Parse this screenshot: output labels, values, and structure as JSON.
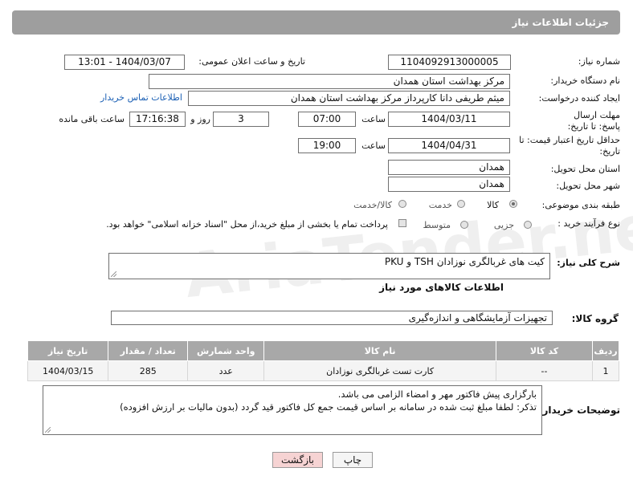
{
  "header": {
    "title": "جزئیات اطلاعات نیاز"
  },
  "fields": {
    "need_number_label": "شماره نیاز:",
    "need_number": "1104092913000005",
    "announce_label": "تاریخ و ساعت اعلان عمومی:",
    "announce_value": "1404/03/07 - 13:01",
    "buyer_label": "نام دستگاه خریدار:",
    "buyer_value": "مرکز بهداشت استان همدان",
    "creator_label": "ایجاد کننده درخواست:",
    "creator_value": "میثم طریفی دانا کارپرداز مرکز بهداشت استان همدان",
    "contact_link": "اطلاعات تماس خریدار",
    "deadline_label": "مهلت ارسال پاسخ: تا تاریخ:",
    "deadline_date": "1404/03/11",
    "time_label": "ساعت",
    "deadline_time": "07:00",
    "days_value": "3",
    "days_label": "روز و",
    "remaining_time": "17:16:38",
    "remaining_label": "ساعت باقی مانده",
    "price_validity_label": "حداقل تاریخ اعتبار قیمت: تا تاریخ:",
    "price_date": "1404/04/31",
    "price_time": "19:00",
    "province_label": "استان محل تحویل:",
    "province_value": "همدان",
    "city_label": "شهر محل تحویل:",
    "city_value": "همدان",
    "category_label": "طبقه بندی موضوعی:",
    "category_options": [
      "کالا",
      "خدمت",
      "کالا/خدمت"
    ],
    "category_selected": "کالا",
    "process_label": "نوع فرآیند خرید :",
    "process_options": [
      "جزیی",
      "متوسط"
    ],
    "payment_note": "پرداخت تمام یا بخشی از مبلغ خرید،از محل \"اسناد خزانه اسلامی\" خواهد بود.",
    "description_label": "شرح کلی نیاز:",
    "description_value": "کیت های غربالگری نوزادان TSH و PKU",
    "goods_info_title": "اطلاعات کالاهای مورد نیاز",
    "goods_group_label": "گروه کالا:",
    "goods_group_value": "تجهیزات آزمایشگاهی و اندازه‌گیری",
    "buyer_notes_label": "توضیحات خریدار:",
    "buyer_notes_line1": "بارگزاری پیش فاکتور مهر و امضاء الزامی می باشد.",
    "buyer_notes_line2": "تذکر: لطفا مبلغ ثبت شده در سامانه بر اساس قیمت جمع کل فاکتور قید گردد (بدون مالیات بر ارزش افزوده)"
  },
  "table": {
    "headers": [
      "ردیف",
      "کد کالا",
      "نام کالا",
      "واحد شمارش",
      "تعداد / مقدار",
      "تاریخ نیاز"
    ],
    "rows": [
      [
        "1",
        "--",
        "کارت تست غربالگری نوزادان",
        "عدد",
        "285",
        "1404/03/15"
      ]
    ]
  },
  "buttons": {
    "print": "چاپ",
    "back": "بازگشت"
  },
  "watermark": "AriaTender.neT",
  "colors": {
    "header_bg": "#9e9e9e",
    "link": "#1a5fb4",
    "table_header": "#a8a8a8",
    "back_button_bg": "#f6d3d3"
  }
}
